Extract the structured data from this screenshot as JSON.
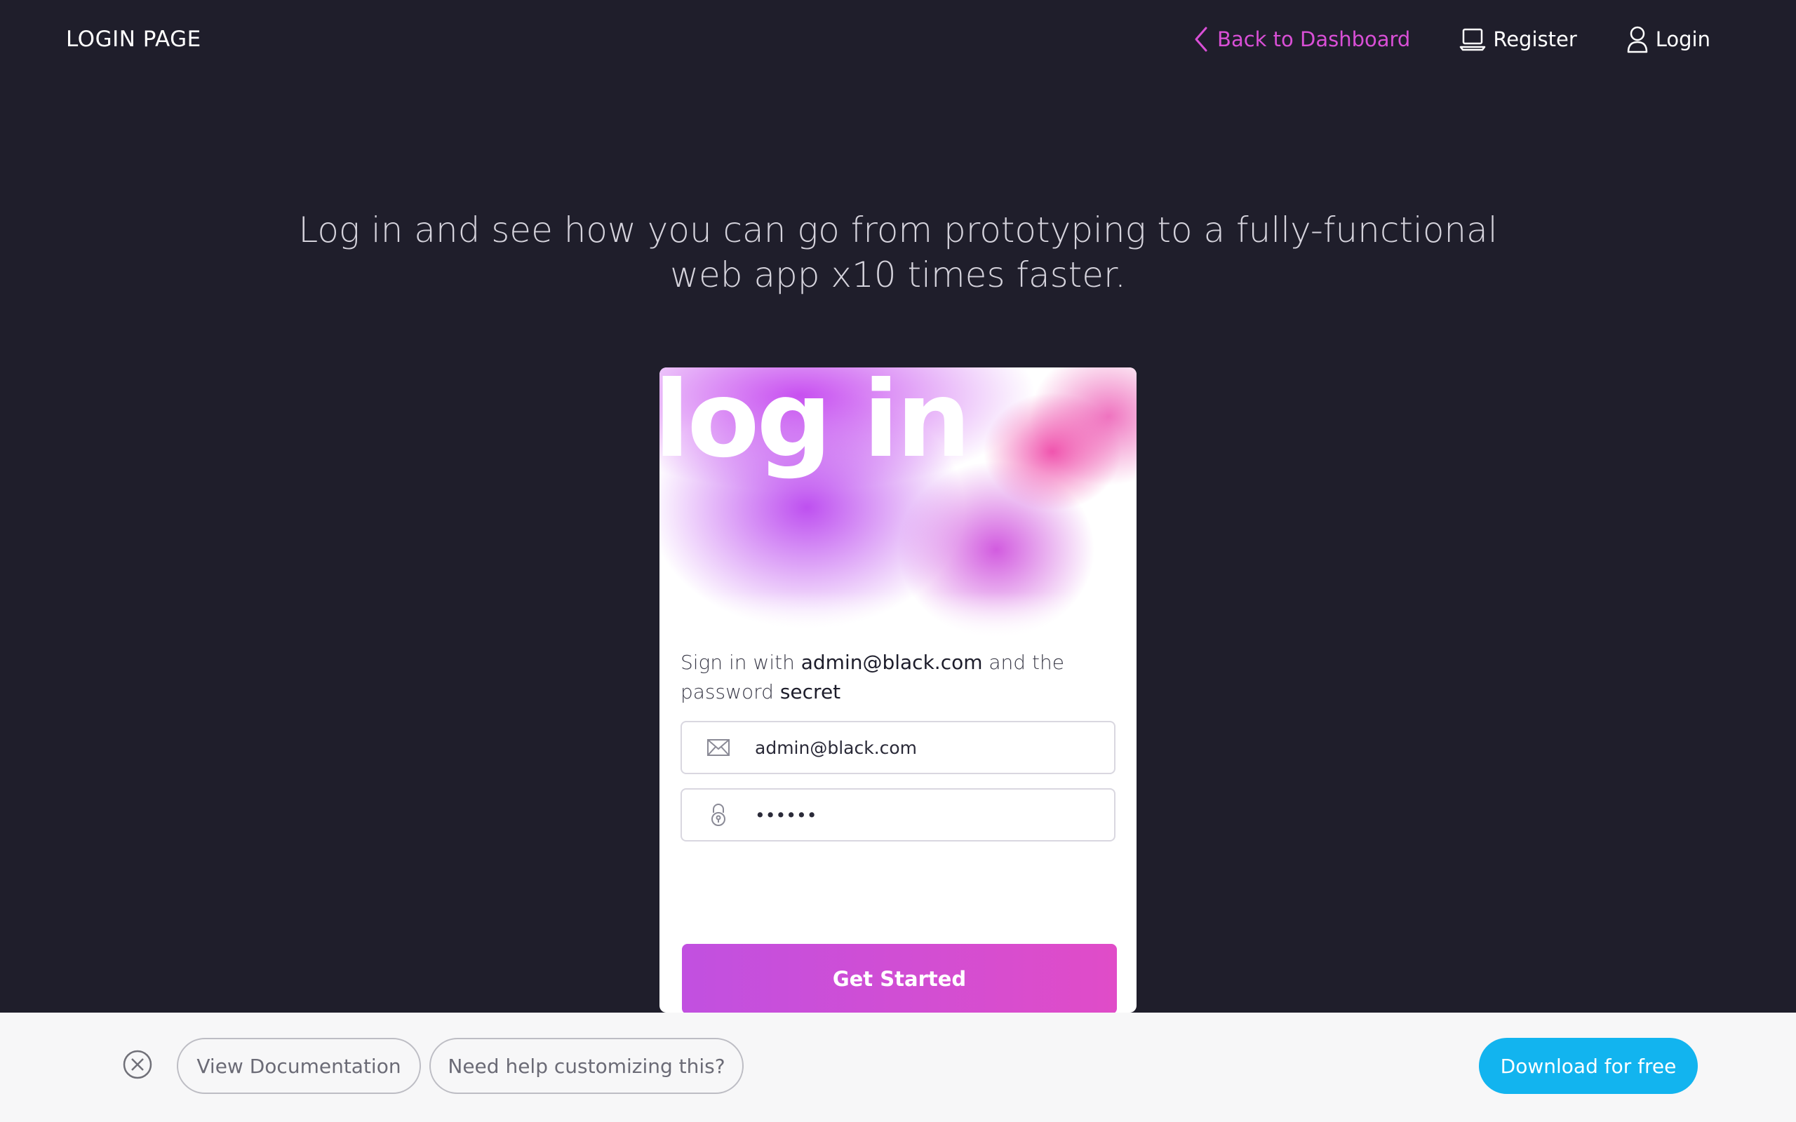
{
  "navbar": {
    "brand": "LOGIN PAGE",
    "back_label": "Back to Dashboard",
    "register_label": "Register",
    "login_label": "Login"
  },
  "headline": "Log in and see how you can go from prototyping to a fully-functional web app x10 times faster.",
  "card": {
    "title": "log in",
    "instructions": {
      "prefix": "Sign in with ",
      "email": "admin@black.com",
      "middle": " and the password ",
      "password": "secret"
    },
    "email_value": "admin@black.com",
    "password_value": "secret",
    "submit_label": "Get Started"
  },
  "bottom_bar": {
    "docs_label": "View Documentation",
    "help_label": "Need help customizing this?",
    "download_label": "Download for free"
  },
  "colors": {
    "background": "#1f1e2b",
    "accent_pink": "#d94fd6",
    "button_gradient_start": "#c150e0",
    "button_gradient_end": "#e04cc8",
    "download_blue": "#12b4ef"
  },
  "icons": {
    "back": "chevron-left-icon",
    "register": "laptop-icon",
    "login": "user-icon",
    "email": "envelope-icon",
    "password": "lock-icon",
    "close": "close-circle-icon"
  }
}
